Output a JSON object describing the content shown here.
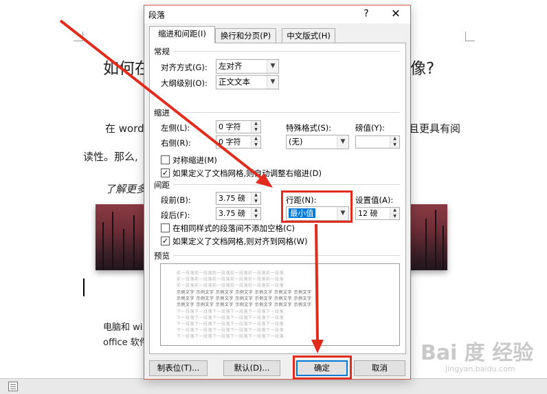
{
  "document": {
    "title_left": "如何在",
    "title_right": "像?",
    "para1_left": "在 word",
    "para1_right": "且更具有阅",
    "para2": "读性。那么,",
    "para3": "了解更多",
    "para4": "电脑和 wi",
    "para5": "office 软件"
  },
  "dialog": {
    "title": "段落",
    "help_label": "?",
    "close_label": "✕",
    "tabs": [
      {
        "label": "缩进和间距(I)",
        "active": true
      },
      {
        "label": "换行和分页(P)",
        "active": false
      },
      {
        "label": "中文版式(H)",
        "active": false
      }
    ],
    "general": {
      "heading": "常规",
      "alignment_label": "对齐方式(G):",
      "alignment_value": "左对齐",
      "outline_label": "大纲级别(O):",
      "outline_value": "正文文本"
    },
    "indent": {
      "heading": "缩进",
      "left_label": "左侧(L):",
      "left_value": "0 字符",
      "right_label": "右侧(R):",
      "right_value": "0 字符",
      "special_label": "特殊格式(S):",
      "special_value": "(无)",
      "by_label": "磅值(Y):",
      "by_value": "",
      "mirror_label": "对称缩进(M)",
      "mirror_checked": false,
      "auto_adjust_label": "如果定义了文档网格,则自动调整右缩进(D)",
      "auto_adjust_checked": true
    },
    "spacing": {
      "heading": "间距",
      "before_label": "段前(B):",
      "before_value": "3.75 磅",
      "after_label": "段后(F):",
      "after_value": "3.75 磅",
      "line_label": "行距(N):",
      "line_value": "最小值",
      "at_label": "设置值(A):",
      "at_value": "12 磅",
      "no_space_label": "在相同样式的段落间不添加空格(C)",
      "no_space_checked": false,
      "snap_grid_label": "如果定义了文档网格,则对齐到网格(W)",
      "snap_grid_checked": true
    },
    "preview": {
      "heading": "预览",
      "prev_text": "前一段落前一段落前一段落前一段落前一段落前一段落",
      "sample_text": "示例文字 示例文字 示例文字 示例文字 示例文字 示例文字 示例文字",
      "next_text": "下一段落下一段落下一段落下一段落下一段落下一段落"
    },
    "buttons": {
      "tabs_label": "制表位(T)...",
      "default_label": "默认(D)...",
      "ok_label": "确定",
      "cancel_label": "取消"
    }
  },
  "watermark": {
    "main": "Bai 度 经验",
    "sub": "jingyan.baidu.com"
  },
  "colors": {
    "annotation_red": "#e12b1d",
    "selection_blue": "#0078d7"
  }
}
